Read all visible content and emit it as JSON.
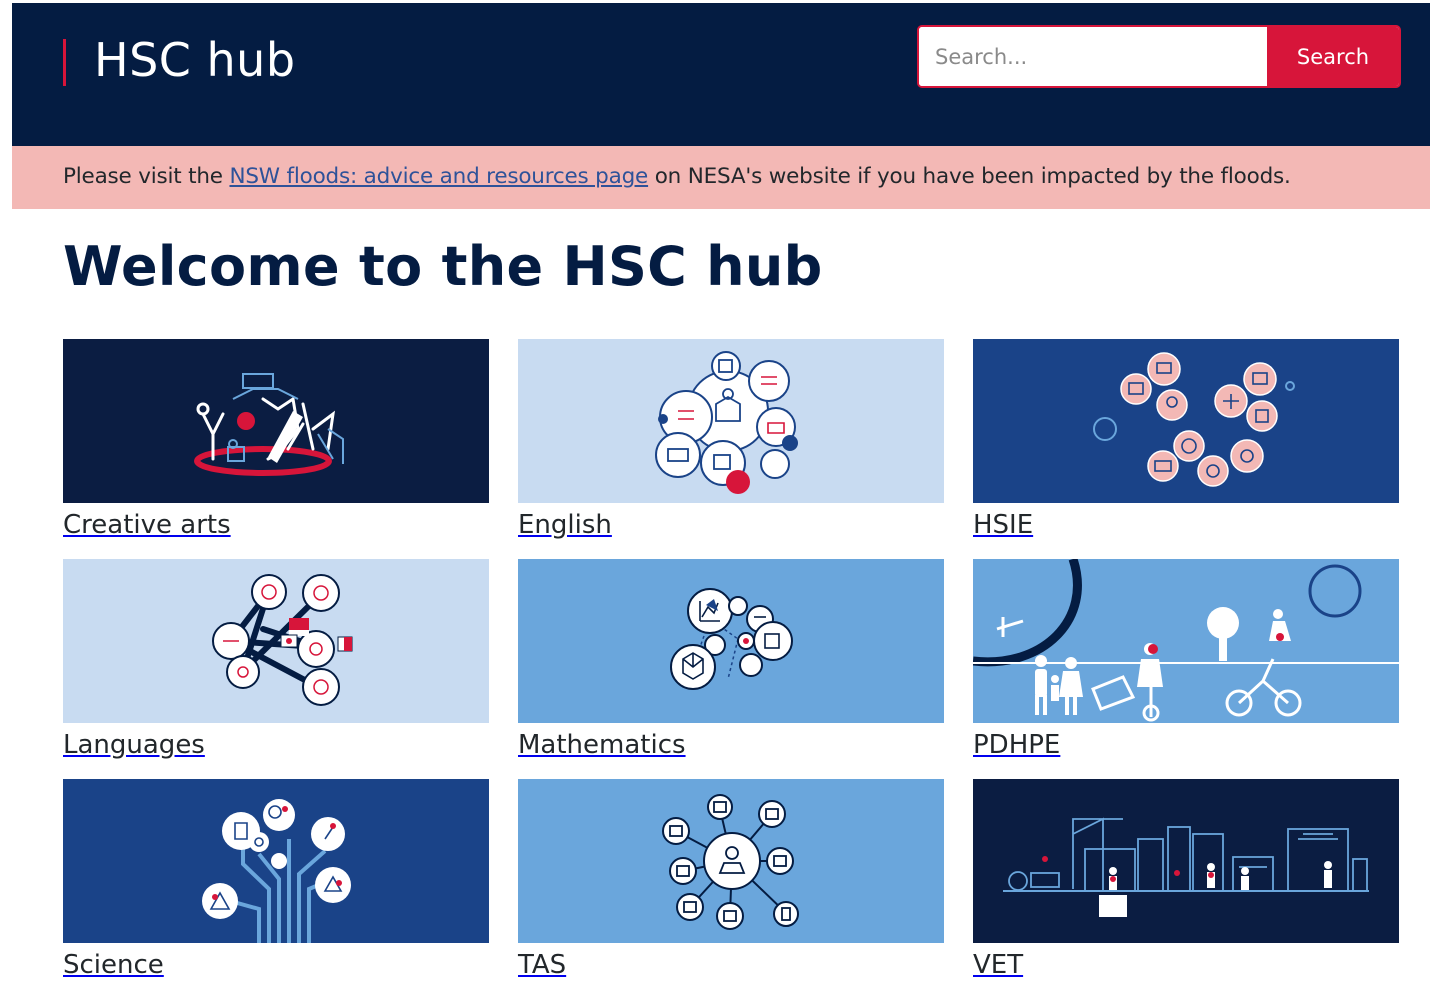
{
  "header": {
    "brand": "HSC hub",
    "search": {
      "placeholder": "Search...",
      "button_label": "Search"
    }
  },
  "alert": {
    "prefix": "Please visit the ",
    "link_text": "NSW floods: advice and resources page",
    "suffix": " on NESA's website if you have been impacted by the floods."
  },
  "page_title": "Welcome to the HSC hub",
  "subjects": [
    {
      "label": "Creative arts",
      "bg": "#0b1d42",
      "icon": "creative-arts-icon"
    },
    {
      "label": "English",
      "bg": "#c8dbf1",
      "icon": "english-icon"
    },
    {
      "label": "HSIE",
      "bg": "#1a4388",
      "icon": "hsie-icon"
    },
    {
      "label": "Languages",
      "bg": "#c8dbf1",
      "icon": "languages-icon"
    },
    {
      "label": "Mathematics",
      "bg": "#6aa6dc",
      "icon": "mathematics-icon"
    },
    {
      "label": "PDHPE",
      "bg": "#6aa6dc",
      "icon": "pdhpe-icon"
    },
    {
      "label": "Science",
      "bg": "#1a4388",
      "icon": "science-icon"
    },
    {
      "label": "TAS",
      "bg": "#6aa6dc",
      "icon": "tas-icon"
    },
    {
      "label": "VET",
      "bg": "#0b1d42",
      "icon": "vet-icon"
    }
  ],
  "colors": {
    "navy": "#041c42",
    "red": "#d7153a",
    "alert_bg": "#f3b8b5",
    "link": "#2e5299"
  }
}
